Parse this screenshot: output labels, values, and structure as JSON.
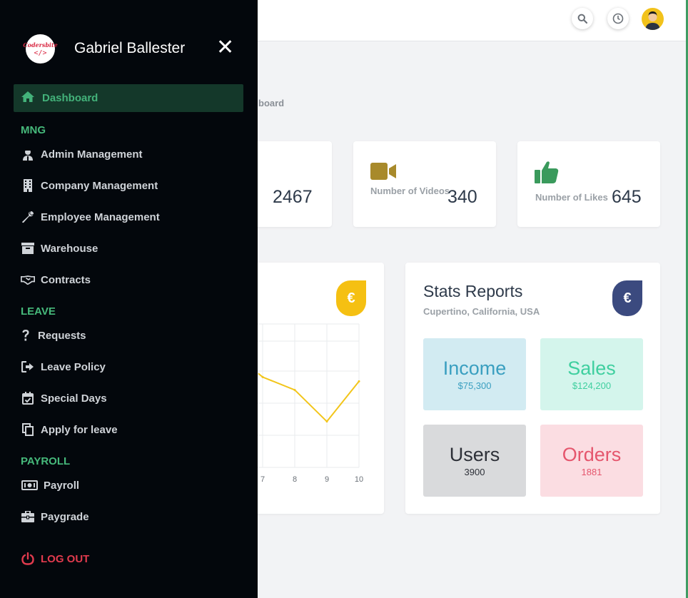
{
  "header": {
    "search_icon": "search-icon",
    "history_icon": "clock-icon",
    "avatar": "user-avatar"
  },
  "breadcrumb": {
    "text": "board"
  },
  "stat_cards": [
    {
      "label": "",
      "value": "2467"
    },
    {
      "label": "Number of Videos",
      "value": "340",
      "icon": "video-camera-icon",
      "color": "#a88a2b"
    },
    {
      "label": "Number of Likes",
      "value": "645",
      "icon": "thumbs-up-icon",
      "color": "#3a9a5c"
    }
  ],
  "chart_card": {
    "badge": "€",
    "badge_color": "#f5c012",
    "chart_data": {
      "type": "line",
      "x": [
        7,
        8,
        9,
        10
      ],
      "xticks": [
        "7",
        "8",
        "9",
        "10"
      ],
      "values": [
        63,
        54,
        32,
        60
      ],
      "line_color": "#f2c51a"
    }
  },
  "stats_reports": {
    "title": "Stats Reports",
    "subtitle": "Cupertino, California, USA",
    "badge": "€",
    "badge_color": "#3b4a7f",
    "tiles": {
      "income": {
        "title": "Income",
        "value": "$75,300"
      },
      "sales": {
        "title": "Sales",
        "value": "$124,200"
      },
      "users": {
        "title": "Users",
        "value": "3900"
      },
      "orders": {
        "title": "Orders",
        "value": "1881"
      }
    }
  },
  "sidebar": {
    "logo_text": "Codersbite",
    "logo_code": "</>",
    "user_name": "Gabriel Ballester",
    "close": "✕",
    "active_item": {
      "label": "Dashboard",
      "icon": "home-icon"
    },
    "sections": {
      "mng": "MNG",
      "leave": "LEAVE",
      "payroll": "PAYROLL"
    },
    "items": [
      {
        "label": "Admin Management",
        "icon": "admin-user-icon"
      },
      {
        "label": "Company Management",
        "icon": "building-icon"
      },
      {
        "label": "Employee Management",
        "icon": "wrench-icon"
      },
      {
        "label": "Warehouse",
        "icon": "archive-box-icon"
      },
      {
        "label": "Contracts",
        "icon": "handshake-icon"
      },
      {
        "label": "Requests",
        "icon": "question-icon"
      },
      {
        "label": "Leave Policy",
        "icon": "sign-out-icon"
      },
      {
        "label": "Special Days",
        "icon": "calendar-check-icon"
      },
      {
        "label": "Apply for leave",
        "icon": "copy-icon"
      },
      {
        "label": "Payroll",
        "icon": "money-bill-icon"
      },
      {
        "label": "Paygrade",
        "icon": "briefcase-icon"
      }
    ],
    "logout": "LOG OUT"
  },
  "colors": {
    "sidebar_bg": "#03070c",
    "accent_green": "#46b97b",
    "logout_red": "#e23b4e"
  }
}
